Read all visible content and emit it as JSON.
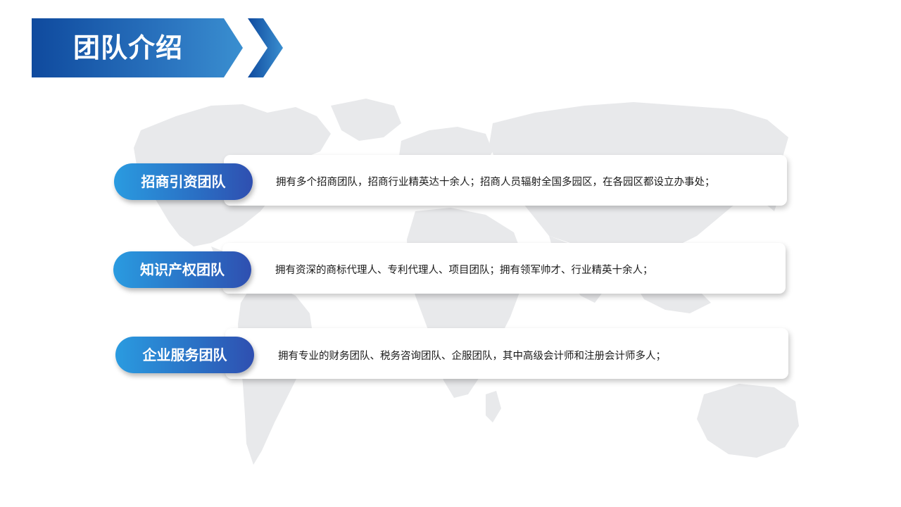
{
  "header": {
    "title": "团队介绍"
  },
  "colors": {
    "primary_blue": "#1d5fb3",
    "accent_blue": "#2a9be0",
    "map_gray": "#e8e9eb",
    "text": "#1a1a1a"
  },
  "teams": [
    {
      "label": "招商引资团队",
      "description": "拥有多个招商团队，招商行业精英达十余人；招商人员辐射全国多园区，在各园区都设立办事处；"
    },
    {
      "label": "知识产权团队",
      "description": "拥有资深的商标代理人、专利代理人、项目团队；拥有领军帅才、行业精英十余人；"
    },
    {
      "label": "企业服务团队",
      "description": "拥有专业的财务团队、税务咨询团队、企服团队，其中高级会计师和注册会计师多人；"
    }
  ]
}
